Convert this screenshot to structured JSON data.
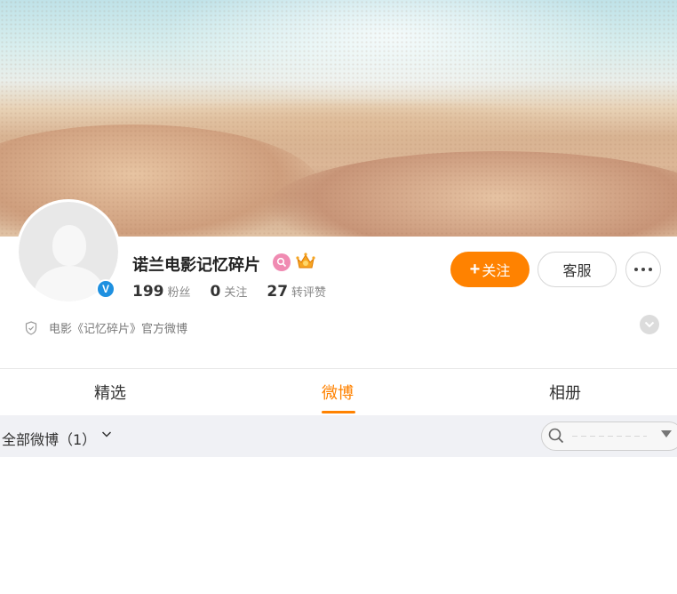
{
  "profile": {
    "name": "诺兰电影记忆碎片",
    "verified_mark": "V",
    "description": "电影《记忆碎片》官方微博",
    "stats": [
      {
        "num": "199",
        "label": "粉丝"
      },
      {
        "num": "0",
        "label": "关注"
      },
      {
        "num": "27",
        "label": "转评赞"
      }
    ]
  },
  "actions": {
    "follow_plus": "+",
    "follow_label": "关注",
    "service_label": "客服"
  },
  "tabs": [
    {
      "label": "精选",
      "active": false
    },
    {
      "label": "微博",
      "active": true
    },
    {
      "label": "相册",
      "active": false
    }
  ],
  "filter": {
    "label": "全部微博（1）",
    "search_placeholder": ""
  },
  "colors": {
    "accent": "#ff8200",
    "verified": "#1e90e0",
    "filter_bg": "#f0f1f5"
  },
  "icons": {
    "verified": "verified-v-icon",
    "badge": "pink-search-badge-icon",
    "crown": "crown-icon",
    "more": "more-dots-icon",
    "desc": "shield-icon",
    "expand": "chevron-down-icon",
    "search": "search-icon"
  }
}
